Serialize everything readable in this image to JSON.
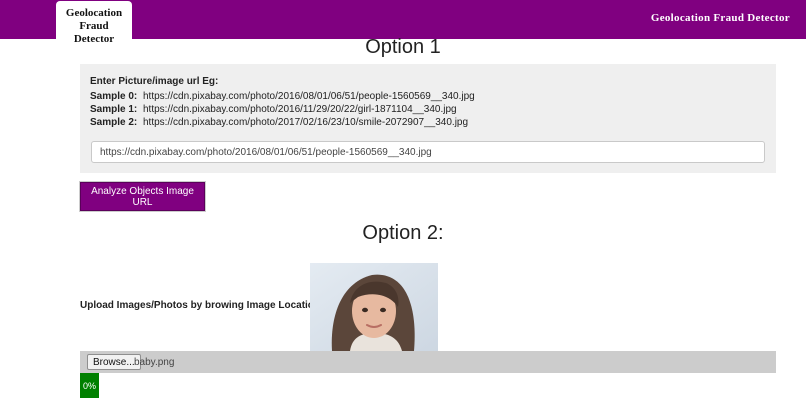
{
  "navbar": {
    "brand_line1": "Geolocation Fraud",
    "brand_line2": "Detector",
    "right_title": "Geolocation Fraud Detector",
    "color": "#800080"
  },
  "option1": {
    "heading": "Option 1",
    "panel_title": "Enter Picture/image url Eg:",
    "samples": [
      {
        "label": "Sample 0:",
        "url": "https://cdn.pixabay.com/photo/2016/08/01/06/51/people-1560569__340.jpg"
      },
      {
        "label": "Sample 1:",
        "url": "https://cdn.pixabay.com/photo/2016/11/29/20/22/girl-1871104__340.jpg"
      },
      {
        "label": "Sample 2:",
        "url": "https://cdn.pixabay.com/photo/2017/02/16/23/10/smile-2072907__340.jpg"
      }
    ],
    "url_input_value": "https://cdn.pixabay.com/photo/2016/08/01/06/51/people-1560569__340.jpg",
    "analyze_button": "Analyze Objects Image URL"
  },
  "option2": {
    "heading": "Option 2:",
    "upload_label": "Upload Images/Photos by browing Image Locations:",
    "browse_button": "Browse...",
    "file_name": "baby.png",
    "progress_text": "0%",
    "progress_value": 0
  }
}
